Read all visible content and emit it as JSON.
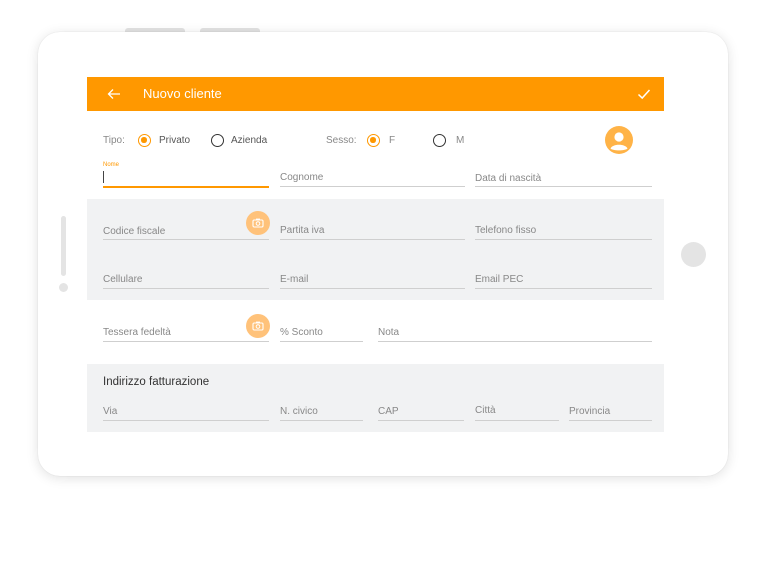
{
  "header": {
    "title": "Nuovo cliente"
  },
  "form": {
    "tipo_label": "Tipo:",
    "tipo_options": [
      "Privato",
      "Azienda"
    ],
    "sesso_label": "Sesso:",
    "sesso_options": [
      "F",
      "M"
    ],
    "nome_label": "Nome",
    "cognome": "Cognome",
    "data_nascita": "Data di nascità",
    "codice_fiscale": "Codice fiscale",
    "partita_iva": "Partita iva",
    "telefono_fisso": "Telefono fisso",
    "cellulare": "Cellulare",
    "email": "E-mail",
    "email_pec": "Email PEC",
    "tessera": "Tessera fedeltà",
    "sconto": "% Sconto",
    "nota": "Nota",
    "indirizzo_title": "Indirizzo fatturazione",
    "via": "Via",
    "civico": "N. civico",
    "cap": "CAP",
    "citta": "Città",
    "provincia": "Provincia"
  },
  "colors": {
    "accent": "#ff9800",
    "accent_light": "#ffc27a",
    "band_gray": "#f1f2f3"
  },
  "icons": {
    "back": "arrow-left-icon",
    "confirm": "check-icon",
    "avatar": "user-avatar-icon",
    "camera": "camera-icon"
  }
}
